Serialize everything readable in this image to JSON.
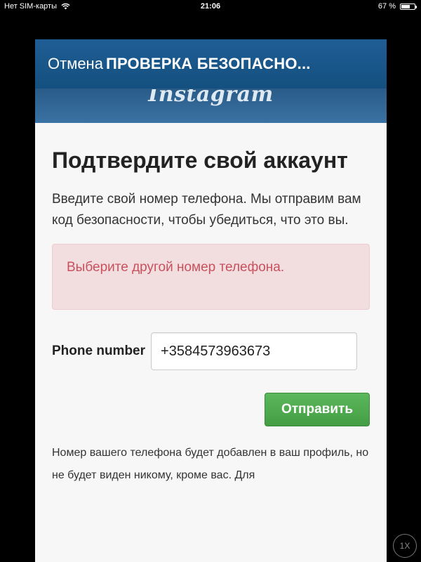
{
  "status_bar": {
    "carrier": "Нет SIM-карты",
    "time": "21:06",
    "battery": "67 %",
    "battery_level": 0.67,
    "wifi_icon": "wifi-icon",
    "battery_icon": "battery-icon"
  },
  "nav": {
    "cancel_label": "Отмена",
    "title": "ПРОВЕРКА БЕЗОПАСНО..."
  },
  "banner": {
    "logo": "Instagram"
  },
  "main": {
    "heading": "Подтвердите свой аккаунт",
    "intro": "Введите свой номер телефона. Мы отправим вам код безопасности, чтобы убедиться, что это вы.",
    "error": "Выберите другой номер телефона.",
    "phone_label": "Phone number",
    "phone_value": "+3584573963673",
    "submit_label": "Отправить",
    "note": "Номер вашего телефона будет добавлен в ваш профиль, но не будет виден никому, кроме вас. Для"
  },
  "zoom": {
    "label": "1X"
  },
  "colors": {
    "nav_bg": "#1a5a8f",
    "error_bg": "#f2dede",
    "error_text": "#c9505e",
    "submit_bg": "#4cae4c"
  }
}
